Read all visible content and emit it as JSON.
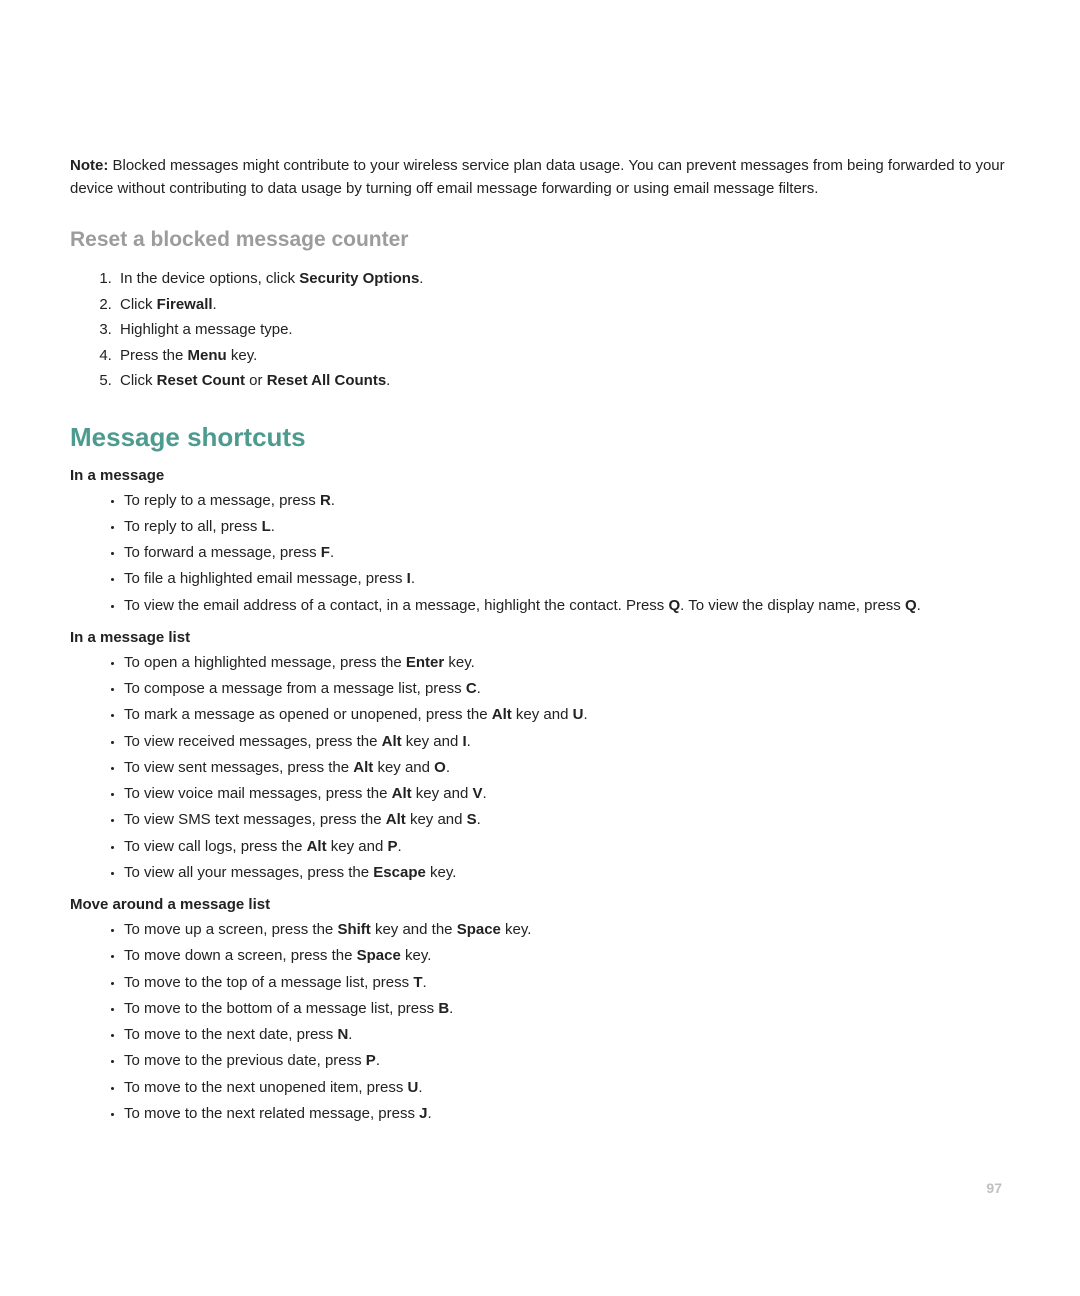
{
  "note": {
    "label": "Note:",
    "text_before": "Blocked messages might contribute to your wireless service plan data usage. You can prevent messages from being forwarded to your device without contributing to data usage by turning off email message forwarding or using email message filters."
  },
  "reset_counter": {
    "heading": "Reset a blocked message counter",
    "steps": {
      "s1a": "In the device options, click ",
      "s1b": "Security Options",
      "s1c": ".",
      "s2a": "Click ",
      "s2b": "Firewall",
      "s2c": ".",
      "s3": "Highlight a message type.",
      "s4a": "Press the ",
      "s4b": "Menu",
      "s4c": " key.",
      "s5a": "Click ",
      "s5b": "Reset Count",
      "s5c": " or ",
      "s5d": "Reset All Counts",
      "s5e": "."
    }
  },
  "shortcuts_heading": "Message shortcuts",
  "in_message": {
    "heading": "In a message",
    "i1a": "To reply to a message, press ",
    "i1b": "R",
    "i1c": ".",
    "i2a": "To reply to all, press ",
    "i2b": "L",
    "i2c": ".",
    "i3a": "To forward a message, press ",
    "i3b": "F",
    "i3c": ".",
    "i4a": "To file a highlighted email message, press ",
    "i4b": "I",
    "i4c": ".",
    "i5a": "To view the email address of a contact, in a message, highlight the contact. Press ",
    "i5b": "Q",
    "i5c": ". To view the display name, press ",
    "i5d": "Q",
    "i5e": "."
  },
  "in_list": {
    "heading": "In a message list",
    "l1a": "To open a highlighted message, press the ",
    "l1b": "Enter",
    "l1c": " key.",
    "l2a": "To compose a message from a message list, press ",
    "l2b": "C",
    "l2c": ".",
    "l3a": "To mark a message as opened or unopened, press the ",
    "l3b": "Alt",
    "l3c": " key and ",
    "l3d": "U",
    "l3e": ".",
    "l4a": "To view received messages, press the ",
    "l4b": "Alt",
    "l4c": " key and ",
    "l4d": "I",
    "l4e": ".",
    "l5a": "To view sent messages, press the ",
    "l5b": "Alt",
    "l5c": " key and ",
    "l5d": "O",
    "l5e": ".",
    "l6a": "To view voice mail messages, press the ",
    "l6b": "Alt",
    "l6c": " key and ",
    "l6d": "V",
    "l6e": ".",
    "l7a": "To view SMS text messages, press the ",
    "l7b": "Alt",
    "l7c": " key and ",
    "l7d": "S",
    "l7e": ".",
    "l8a": "To view call logs, press the ",
    "l8b": "Alt",
    "l8c": " key and ",
    "l8d": "P",
    "l8e": ".",
    "l9a": "To view all your messages, press the ",
    "l9b": "Escape",
    "l9c": " key."
  },
  "move_list": {
    "heading": "Move around a message list",
    "m1a": "To move up a screen, press the ",
    "m1b": "Shift",
    "m1c": " key and the ",
    "m1d": "Space",
    "m1e": " key.",
    "m2a": "To move down a screen, press the ",
    "m2b": "Space",
    "m2c": " key.",
    "m3a": "To move to the top of a message list, press ",
    "m3b": "T",
    "m3c": ".",
    "m4a": "To move to the bottom of a message list, press ",
    "m4b": "B",
    "m4c": ".",
    "m5a": "To move to the next date, press ",
    "m5b": "N",
    "m5c": ".",
    "m6a": "To move to the previous date, press ",
    "m6b": "P",
    "m6c": ".",
    "m7a": "To move to the next unopened item, press ",
    "m7b": "U",
    "m7c": ".",
    "m8a": "To move to the next related message, press ",
    "m8b": "J",
    "m8c": "."
  },
  "page_number": "97"
}
